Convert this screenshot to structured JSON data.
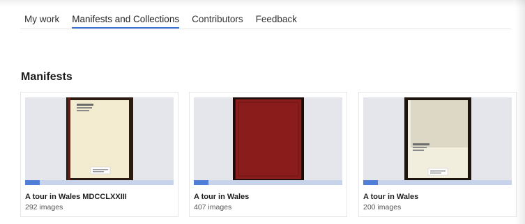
{
  "nav": {
    "tabs": [
      {
        "label": "My work"
      },
      {
        "label": "Manifests and Collections",
        "active": true
      },
      {
        "label": "Contributors"
      },
      {
        "label": "Feedback"
      }
    ],
    "accent_color": "#3a72d8"
  },
  "manifests": {
    "heading": "Manifests",
    "items": [
      {
        "title": "A tour in Wales MDCCLXXIII",
        "count": "292 images",
        "progress": 0.1,
        "cover_color": "#f3ecd0",
        "spine_color": "#2a1a12"
      },
      {
        "title": "A tour in Wales",
        "count": "407 images",
        "progress": 0.1,
        "cover_color": "#8a1c1c",
        "spine_color": "#1a0a08"
      },
      {
        "title": "A tour in Wales",
        "count": "200 images",
        "progress": 0.1,
        "cover_color": "#e9e4d3",
        "spine_color": "#1e140e"
      }
    ]
  }
}
